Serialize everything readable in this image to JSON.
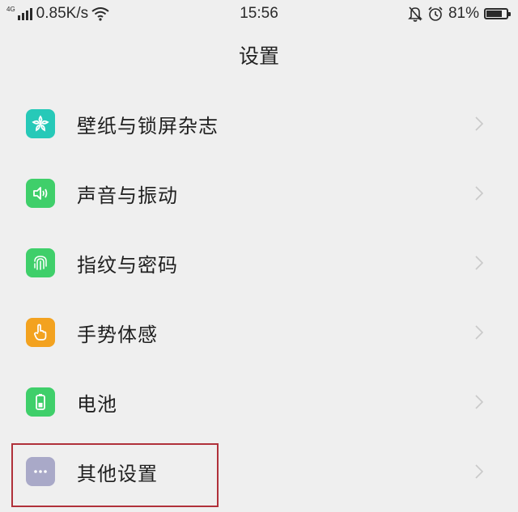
{
  "status_bar": {
    "network_type": "4G",
    "speed": "0.85K/s",
    "time": "15:56",
    "battery_percent": "81%",
    "battery_level": 0.81
  },
  "page": {
    "title": "设置"
  },
  "items": [
    {
      "label": "壁纸与锁屏杂志",
      "icon": "flower-icon",
      "color": "#27c9b8"
    },
    {
      "label": "声音与振动",
      "icon": "speaker-icon",
      "color": "#3fcf6a"
    },
    {
      "label": "指纹与密码",
      "icon": "fingerprint-icon",
      "color": "#3fcf6a"
    },
    {
      "label": "手势体感",
      "icon": "hand-pointer-icon",
      "color": "#f3a21f"
    },
    {
      "label": "电池",
      "icon": "battery-icon",
      "color": "#3fcf6a"
    },
    {
      "label": "其他设置",
      "icon": "more-dots-icon",
      "color": "#a9a9c8"
    }
  ],
  "highlight_color": "#b0313a"
}
